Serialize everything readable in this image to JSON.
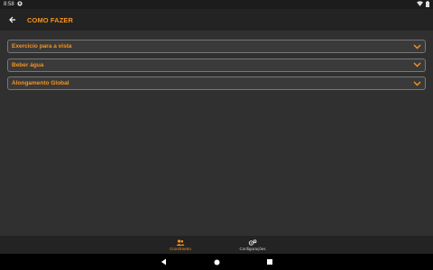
{
  "status_bar": {
    "time": "8:58"
  },
  "app_bar": {
    "title": "COMO FAZER"
  },
  "accordion": [
    {
      "label": "Exercicio para a vista"
    },
    {
      "label": "Beber água"
    },
    {
      "label": "Alongamento Global"
    }
  ],
  "bottom_nav": {
    "items": [
      {
        "label": "Cronômetro",
        "icon": "people-icon",
        "active": true
      },
      {
        "label": "Configurações",
        "icon": "gears-icon",
        "active": false
      }
    ]
  },
  "colors": {
    "accent": "#f7931e",
    "background": "#303030",
    "bar": "#232323"
  }
}
